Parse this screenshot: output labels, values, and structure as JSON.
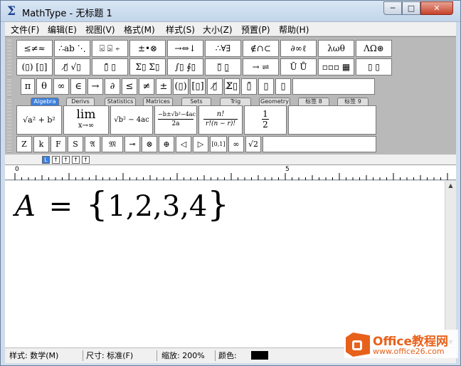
{
  "window": {
    "title": "MathType - 无标题 1",
    "controls": {
      "minimize": "─",
      "maximize": "□",
      "close": "✕"
    }
  },
  "menu": [
    "文件(F)",
    "编辑(E)",
    "视图(V)",
    "格式(M)",
    "样式(S)",
    "大小(Z)",
    "预置(P)",
    "帮助(H)"
  ],
  "palettes": {
    "row1": [
      "≤≠≈",
      "∴ab ⋱",
      "⍃ ⍄ ⍅",
      "±•⊗",
      "→⇔↓",
      "∴∀∃",
      "∉∩⊂",
      "∂∞ℓ",
      "λωθ",
      "ΛΩ⊛"
    ],
    "row2": [
      "(▯) [▯]",
      "▯̸ √▯",
      "▯̄ ▯",
      "Σ▯ Σ▯",
      "∫▯ ∮▯",
      "▯̅ ▯̲",
      "→ ⇌",
      "Ū Ů",
      "▫▫▫ ▦",
      "▯ ▯"
    ],
    "row3": [
      "π",
      "θ",
      "∞",
      "∈",
      "→",
      "∂",
      "≤",
      "≠",
      "±",
      "(▯)",
      "[▯]",
      "▯̸",
      "Σ̸▯",
      "▯̄",
      "▯",
      "▯"
    ]
  },
  "tabs": [
    "Algebra",
    "Derivs",
    "Statistics",
    "Matrices",
    "Sets",
    "Trig",
    "Geometry",
    "标签 8",
    "标签 9"
  ],
  "templates": [
    {
      "name": "sqrt-a2-b2",
      "text": "√a² + b²"
    },
    {
      "name": "limit",
      "text": "lim",
      "sub": "x→∞"
    },
    {
      "name": "sqrt-b2-4ac",
      "text": "√b² − 4ac"
    },
    {
      "name": "quadratic",
      "text": "−b±√b²−4ac",
      "sub": "2a"
    },
    {
      "name": "combination",
      "text": "n!",
      "sub": "r!(n − r)!"
    },
    {
      "name": "half",
      "text": "1",
      "sub": "2"
    }
  ],
  "small_symbols": [
    "Z",
    "k",
    "F",
    "S",
    "𝔄",
    "𝔐",
    "⊸",
    "⊗",
    "⊕",
    "◁",
    "▷",
    "[0,1]",
    "∞",
    "√2"
  ],
  "tab_buttons": [
    "L",
    "↑",
    "↑",
    "↑",
    "↑"
  ],
  "ruler": {
    "labels": [
      "0",
      "5"
    ]
  },
  "equation": {
    "lhs": "A",
    "eq": "=",
    "open": "{",
    "body": "1,2,3,4",
    "close": "}"
  },
  "status": {
    "style": "样式: 数学(M)",
    "size": "尺寸: 标准(F)",
    "zoom": "缩放: 200%",
    "color_label": "颜色:",
    "color_value": "#000000"
  },
  "watermark": {
    "title": "Office教程网",
    "url": "www.office26.com"
  }
}
